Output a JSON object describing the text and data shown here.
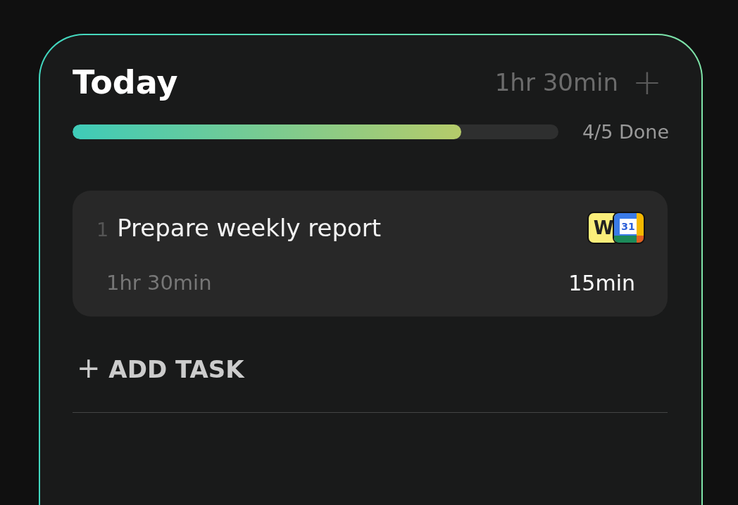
{
  "header": {
    "title": "Today",
    "total": "1hr 30min",
    "add_icon": "+"
  },
  "progress": {
    "level": 0.8,
    "label": "4/5 Done"
  },
  "tasks": [
    {
      "number": "1",
      "title": "Prepare weekly report",
      "estimate": "1hr 30min",
      "spent": "15min",
      "apps": [
        {
          "kind": "word",
          "label": "W"
        },
        {
          "kind": "calendar",
          "label": "31"
        }
      ]
    }
  ],
  "add_task": {
    "icon": "+",
    "label": "ADD TASK"
  }
}
